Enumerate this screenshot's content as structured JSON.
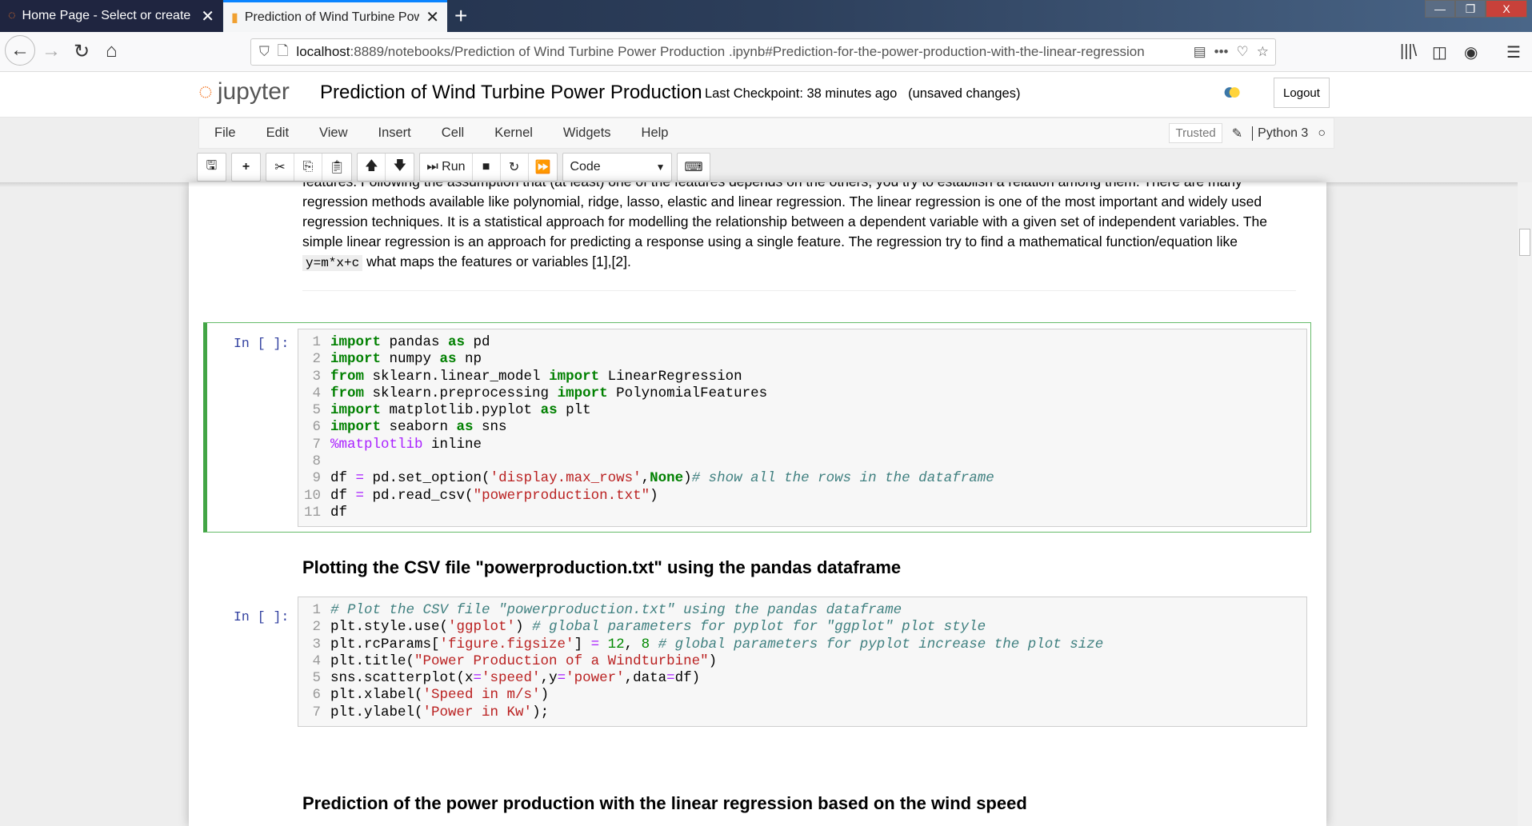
{
  "browser": {
    "tabs": [
      {
        "title": "Home Page - Select or create a notebook",
        "active": false
      },
      {
        "title": "Prediction of Wind Turbine Power Production",
        "active": true
      }
    ],
    "url_host": "localhost",
    "url_rest": ":8889/notebooks/Prediction of Wind Turbine Power Production .ipynb#Prediction-for-the-power-production-with-the-linear-regression"
  },
  "header": {
    "logo": "jupyter",
    "title": "Prediction of Wind Turbine Power Production",
    "checkpoint": "Last Checkpoint: 38 minutes ago",
    "unsaved": "(unsaved changes)",
    "logout": "Logout"
  },
  "menu": [
    "File",
    "Edit",
    "View",
    "Insert",
    "Cell",
    "Kernel",
    "Widgets",
    "Help"
  ],
  "kernel": {
    "trusted": "Trusted",
    "name": "Python 3"
  },
  "toolbar": {
    "run": "Run",
    "cell_type": "Code"
  },
  "markdown": {
    "lines": [
      "features. Following the assumption that (at least) one of the features depends on the others, you try to establish a relation among them. There are many",
      "regression methods available like polynomial, ridge, lasso, elastic and linear regression. The linear regression is one of the most important and widely used",
      "regression techniques. It is a statistical approach for modelling the relationship between a dependent variable with a given set of independent variables. The",
      "simple linear regression is an approach for predicting a response using a single feature. The regression try to find a mathematical function/equation like"
    ],
    "code": "y=m*x+c",
    "tail": " what maps the features or variables [1],[2]."
  },
  "cells": [
    {
      "prompt": "In [ ]:",
      "lines": [
        "import pandas as pd",
        "import numpy as np",
        "from sklearn.linear_model import LinearRegression",
        "from sklearn.preprocessing import PolynomialFeatures",
        "import matplotlib.pyplot as plt",
        "import seaborn as sns",
        "%matplotlib inline",
        "",
        "df = pd.set_option('display.max_rows',None)# show all the rows in the dataframe",
        "df = pd.read_csv(\"powerproduction.txt\")",
        "df"
      ]
    },
    {
      "prompt": "In [ ]:",
      "lines": [
        "# Plot the CSV file \"powerproduction.txt\" using the pandas dataframe",
        "plt.style.use('ggplot') # global parameters for pyplot for \"ggplot\" plot style",
        "plt.rcParams['figure.figsize'] = 12, 8 # global parameters for pyplot increase the plot size",
        "plt.title(\"Power Production of a Windturbine\")",
        "sns.scatterplot(x='speed',y='power',data=df)",
        "plt.xlabel('Speed in m/s')",
        "plt.ylabel('Power in Kw');"
      ]
    }
  ],
  "headings": [
    "Plotting the CSV file \"powerproduction.txt\" using the pandas dataframe",
    "Prediction of the power production with the linear regression based on the wind speed"
  ]
}
